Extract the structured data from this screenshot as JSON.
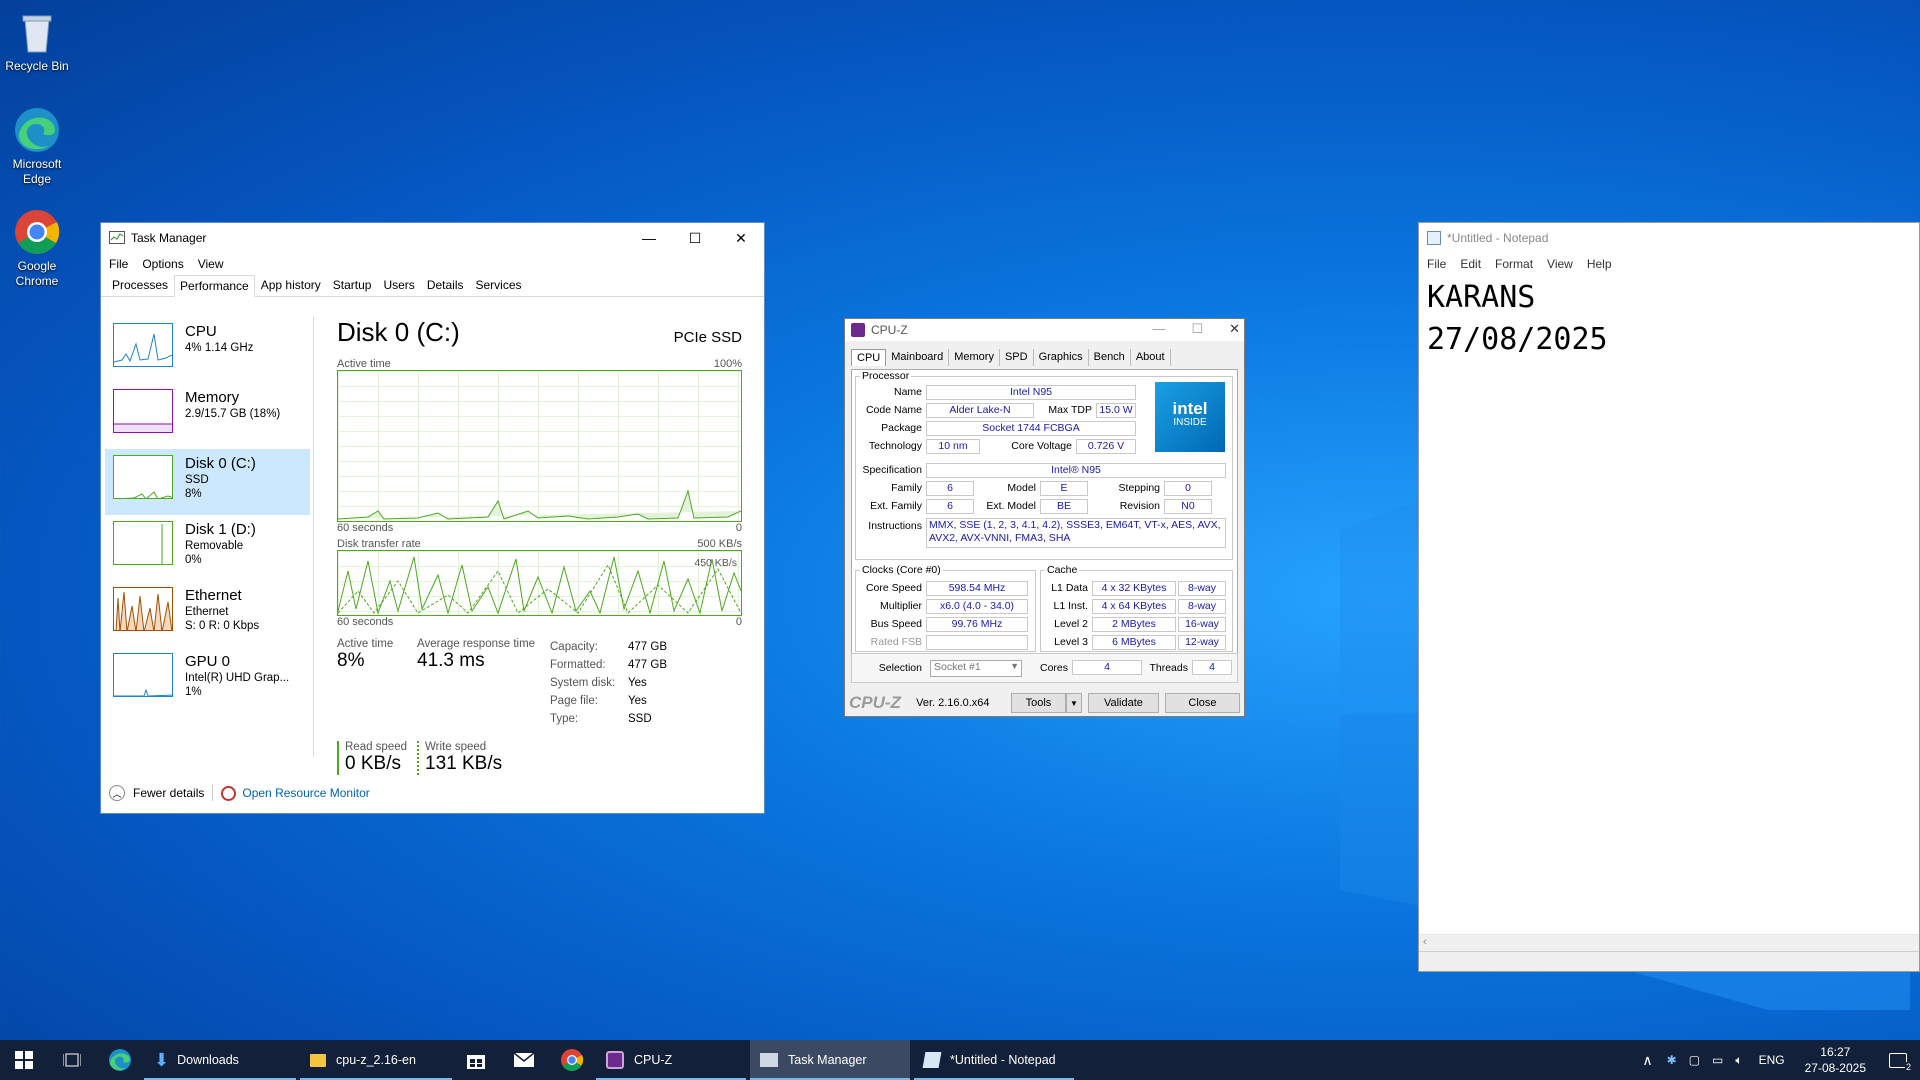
{
  "desktop": {
    "icons": [
      {
        "label": "Recycle Bin"
      },
      {
        "label": "Microsoft Edge"
      },
      {
        "label": "Google Chrome"
      }
    ]
  },
  "taskmgr": {
    "title": "Task Manager",
    "menu": [
      "File",
      "Options",
      "View"
    ],
    "tabs": [
      "Processes",
      "Performance",
      "App history",
      "Startup",
      "Users",
      "Details",
      "Services"
    ],
    "active_tab": "Performance",
    "sidebar": [
      {
        "name": "CPU",
        "sub1": "4% 1.14 GHz",
        "sub2": "",
        "sub3": ""
      },
      {
        "name": "Memory",
        "sub1": "2.9/15.7 GB (18%)",
        "sub2": "",
        "sub3": ""
      },
      {
        "name": "Disk 0 (C:)",
        "sub1": "SSD",
        "sub2": "8%",
        "sub3": ""
      },
      {
        "name": "Disk 1 (D:)",
        "sub1": "Removable",
        "sub2": "0%",
        "sub3": ""
      },
      {
        "name": "Ethernet",
        "sub1": "Ethernet",
        "sub2": "S: 0 R: 0 Kbps",
        "sub3": ""
      },
      {
        "name": "GPU 0",
        "sub1": "Intel(R) UHD Grap...",
        "sub2": "1%",
        "sub3": ""
      }
    ],
    "main": {
      "title": "Disk 0 (C:)",
      "type": "PCIe SSD",
      "graph1_label": "Active time",
      "graph1_max": "100%",
      "graph1_xl": "60 seconds",
      "graph1_xr": "0",
      "graph2_label": "Disk transfer rate",
      "graph2_max": "500 KB/s",
      "graph2_marker": "450 KB/s",
      "graph2_xl": "60 seconds",
      "graph2_xr": "0",
      "active_time_label": "Active time",
      "active_time": "8%",
      "avg_resp_label": "Average response time",
      "avg_resp": "41.3 ms",
      "read_label": "Read speed",
      "read": "0 KB/s",
      "write_label": "Write speed",
      "write": "131 KB/s",
      "props": [
        {
          "k": "Capacity:",
          "v": "477 GB"
        },
        {
          "k": "Formatted:",
          "v": "477 GB"
        },
        {
          "k": "System disk:",
          "v": "Yes"
        },
        {
          "k": "Page file:",
          "v": "Yes"
        },
        {
          "k": "Type:",
          "v": "SSD"
        }
      ]
    },
    "footer": {
      "fewer": "Fewer details",
      "monitor": "Open Resource Monitor"
    }
  },
  "cpuz": {
    "title": "CPU-Z",
    "tabs": [
      "CPU",
      "Mainboard",
      "Memory",
      "SPD",
      "Graphics",
      "Bench",
      "About"
    ],
    "processor_legend": "Processor",
    "name_lbl": "Name",
    "name": "Intel N95",
    "codename_lbl": "Code Name",
    "codename": "Alder Lake-N",
    "maxtdp_lbl": "Max TDP",
    "maxtdp": "15.0 W",
    "package_lbl": "Package",
    "package": "Socket 1744 FCBGA",
    "tech_lbl": "Technology",
    "tech": "10 nm",
    "corev_lbl": "Core Voltage",
    "corev": "0.726 V",
    "spec_lbl": "Specification",
    "spec": "Intel® N95",
    "family_lbl": "Family",
    "family": "6",
    "model_lbl": "Model",
    "model": "E",
    "stepping_lbl": "Stepping",
    "stepping": "0",
    "extfam_lbl": "Ext. Family",
    "extfam": "6",
    "extmodel_lbl": "Ext. Model",
    "extmodel": "BE",
    "revision_lbl": "Revision",
    "revision": "N0",
    "instr_lbl": "Instructions",
    "instr1": "MMX, SSE (1, 2, 3, 4.1, 4.2), SSSE3, EM64T, VT-x, AES, AVX,",
    "instr2": "AVX2, AVX-VNNI, FMA3, SHA",
    "logo_line1": "intel",
    "logo_line2": "INSIDE",
    "clocks_legend": "Clocks (Core #0)",
    "corespeed_lbl": "Core Speed",
    "corespeed": "598.54 MHz",
    "mult_lbl": "Multiplier",
    "mult": "x6.0 (4.0 - 34.0)",
    "bus_lbl": "Bus Speed",
    "bus": "99.76 MHz",
    "rated_lbl": "Rated FSB",
    "rated": "",
    "cache_legend": "Cache",
    "l1d_lbl": "L1 Data",
    "l1d": "4 x 32 KBytes",
    "l1d_way": "8-way",
    "l1i_lbl": "L1 Inst.",
    "l1i": "4 x 64 KBytes",
    "l1i_way": "8-way",
    "l2_lbl": "Level 2",
    "l2": "2 MBytes",
    "l2_way": "16-way",
    "l3_lbl": "Level 3",
    "l3": "6 MBytes",
    "l3_way": "12-way",
    "selection_lbl": "Selection",
    "selection": "Socket #1",
    "cores_lbl": "Cores",
    "cores": "4",
    "threads_lbl": "Threads",
    "threads": "4",
    "brand": "CPU-Z",
    "version": "Ver. 2.16.0.x64",
    "tools": "Tools",
    "validate": "Validate",
    "close": "Close"
  },
  "notepad": {
    "title": "*Untitled - Notepad",
    "menu": [
      "File",
      "Edit",
      "Format",
      "View",
      "Help"
    ],
    "content": "KARANS\n27/08/2025"
  },
  "taskbar": {
    "apps": [
      {
        "label": "Downloads"
      },
      {
        "label": "cpu-z_2.16-en"
      },
      {
        "label": "CPU-Z"
      },
      {
        "label": "Task Manager"
      },
      {
        "label": "*Untitled - Notepad"
      }
    ],
    "lang": "ENG",
    "time": "16:27",
    "date": "27-08-2025",
    "notif_count": "2"
  },
  "colors": {
    "accent": "#0078d7",
    "graph_green": "#4da81d",
    "taskbar": "#13203a"
  }
}
